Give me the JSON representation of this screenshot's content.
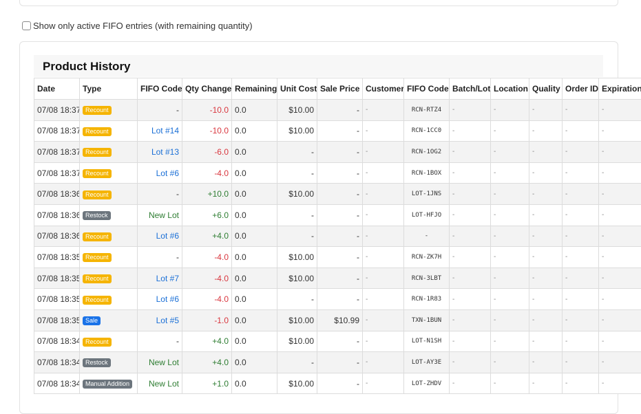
{
  "filter": {
    "label": "Show only active FIFO entries (with remaining quantity)",
    "checked": false
  },
  "history": {
    "title": "Product History",
    "columns": [
      "Date",
      "Type",
      "FIFO Code",
      "Qty Change",
      "Remaining",
      "Unit Cost",
      "Sale Price",
      "Customer",
      "FIFO Code",
      "Batch/Lot",
      "Location",
      "Quality",
      "Order ID",
      "Expiration"
    ],
    "rows": [
      {
        "date": "07/08 18:37",
        "type": "Recount",
        "fifo": "-",
        "qty": "-10.0",
        "remaining": "0.0",
        "cost": "$10.00",
        "price": "-",
        "customer": "-",
        "code": "RCN-RTZ4",
        "batch": "-",
        "location": "-",
        "quality": "-",
        "order": "-",
        "expiration": "-"
      },
      {
        "date": "07/08 18:37",
        "type": "Recount",
        "fifo": "Lot #14",
        "qty": "-10.0",
        "remaining": "0.0",
        "cost": "$10.00",
        "price": "-",
        "customer": "-",
        "code": "RCN-1CC0",
        "batch": "-",
        "location": "-",
        "quality": "-",
        "order": "-",
        "expiration": "-"
      },
      {
        "date": "07/08 18:37",
        "type": "Recount",
        "fifo": "Lot #13",
        "qty": "-6.0",
        "remaining": "0.0",
        "cost": "-",
        "price": "-",
        "customer": "-",
        "code": "RCN-1OG2",
        "batch": "-",
        "location": "-",
        "quality": "-",
        "order": "-",
        "expiration": "-"
      },
      {
        "date": "07/08 18:37",
        "type": "Recount",
        "fifo": "Lot #6",
        "qty": "-4.0",
        "remaining": "0.0",
        "cost": "-",
        "price": "-",
        "customer": "-",
        "code": "RCN-1BOX",
        "batch": "-",
        "location": "-",
        "quality": "-",
        "order": "-",
        "expiration": "-"
      },
      {
        "date": "07/08 18:36",
        "type": "Recount",
        "fifo": "-",
        "qty": "+10.0",
        "remaining": "0.0",
        "cost": "$10.00",
        "price": "-",
        "customer": "-",
        "code": "LOT-1JNS",
        "batch": "-",
        "location": "-",
        "quality": "-",
        "order": "-",
        "expiration": "-"
      },
      {
        "date": "07/08 18:36",
        "type": "Restock",
        "fifo": "New Lot",
        "qty": "+6.0",
        "remaining": "0.0",
        "cost": "-",
        "price": "-",
        "customer": "-",
        "code": "LOT-HFJO",
        "batch": "-",
        "location": "-",
        "quality": "-",
        "order": "-",
        "expiration": "-"
      },
      {
        "date": "07/08 18:36",
        "type": "Recount",
        "fifo": "Lot #6",
        "qty": "+4.0",
        "remaining": "0.0",
        "cost": "-",
        "price": "-",
        "customer": "-",
        "code": "-",
        "batch": "-",
        "location": "-",
        "quality": "-",
        "order": "-",
        "expiration": "-"
      },
      {
        "date": "07/08 18:35",
        "type": "Recount",
        "fifo": "-",
        "qty": "-4.0",
        "remaining": "0.0",
        "cost": "$10.00",
        "price": "-",
        "customer": "-",
        "code": "RCN-ZK7H",
        "batch": "-",
        "location": "-",
        "quality": "-",
        "order": "-",
        "expiration": "-"
      },
      {
        "date": "07/08 18:35",
        "type": "Recount",
        "fifo": "Lot #7",
        "qty": "-4.0",
        "remaining": "0.0",
        "cost": "$10.00",
        "price": "-",
        "customer": "-",
        "code": "RCN-3LBT",
        "batch": "-",
        "location": "-",
        "quality": "-",
        "order": "-",
        "expiration": "-"
      },
      {
        "date": "07/08 18:35",
        "type": "Recount",
        "fifo": "Lot #6",
        "qty": "-4.0",
        "remaining": "0.0",
        "cost": "-",
        "price": "-",
        "customer": "-",
        "code": "RCN-1R83",
        "batch": "-",
        "location": "-",
        "quality": "-",
        "order": "-",
        "expiration": "-"
      },
      {
        "date": "07/08 18:35",
        "type": "Sale",
        "fifo": "Lot #5",
        "qty": "-1.0",
        "remaining": "0.0",
        "cost": "$10.00",
        "price": "$10.99",
        "customer": "-",
        "code": "TXN-1BUN",
        "batch": "-",
        "location": "-",
        "quality": "-",
        "order": "-",
        "expiration": "-"
      },
      {
        "date": "07/08 18:34",
        "type": "Recount",
        "fifo": "-",
        "qty": "+4.0",
        "remaining": "0.0",
        "cost": "$10.00",
        "price": "-",
        "customer": "-",
        "code": "LOT-N1SH",
        "batch": "-",
        "location": "-",
        "quality": "-",
        "order": "-",
        "expiration": "-"
      },
      {
        "date": "07/08 18:34",
        "type": "Restock",
        "fifo": "New Lot",
        "qty": "+4.0",
        "remaining": "0.0",
        "cost": "-",
        "price": "-",
        "customer": "-",
        "code": "LOT-AY3E",
        "batch": "-",
        "location": "-",
        "quality": "-",
        "order": "-",
        "expiration": "-"
      },
      {
        "date": "07/08 18:34",
        "type": "Manual Addition",
        "fifo": "New Lot",
        "qty": "+1.0",
        "remaining": "0.0",
        "cost": "$10.00",
        "price": "-",
        "customer": "-",
        "code": "LOT-ZHDV",
        "batch": "-",
        "location": "-",
        "quality": "-",
        "order": "-",
        "expiration": "-"
      }
    ]
  },
  "colors": {
    "recount": "#f5b400",
    "restock": "#6c757d",
    "sale": "#1a73e8",
    "negative": "#d9363e",
    "positive": "#2e7d32",
    "link": "#1a6fd6"
  }
}
